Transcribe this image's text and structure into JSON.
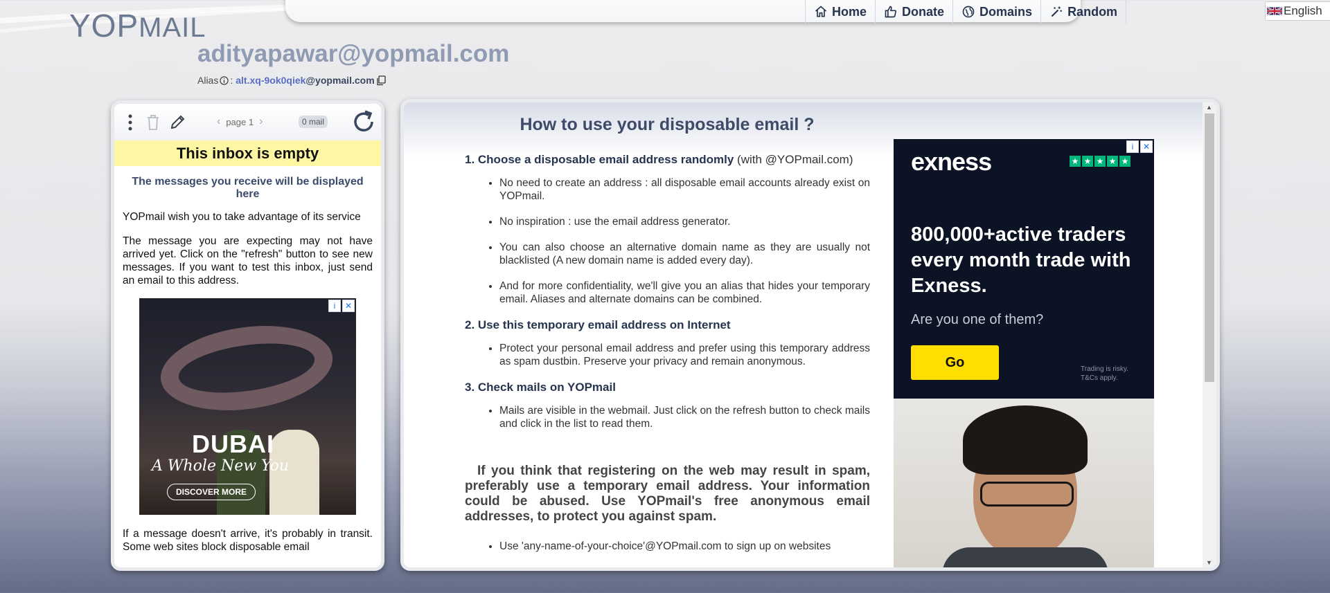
{
  "logo": {
    "text_big": "YOP",
    "text_small": "MAIL"
  },
  "nav": {
    "home": "Home",
    "donate": "Donate",
    "domains": "Domains",
    "random": "Random"
  },
  "language": {
    "selected": "English"
  },
  "inbox": {
    "email": "adityapawar@yopmail.com",
    "alias_label": "Alias",
    "alias_sep": ":",
    "alias_value": "alt.xq-9ok0qiek",
    "alias_domain": "@yopmail.com"
  },
  "left": {
    "page": "page 1",
    "mail_count": "0 mail",
    "empty_title": "This inbox is empty",
    "receive_note": "The messages you receive will be displayed here",
    "wish": "YOPmail wish you to take advantage of its service",
    "expect": "The message you are expecting may not have arrived yet. Click on the \"refresh\" button to see new messages. If you want to test this inbox, just send an email to this address.",
    "transit": "If a message doesn't arrive, it's probably in transit. Some web sites block disposable email",
    "ad": {
      "brand": "DUBAI",
      "tagline": "A Whole New You",
      "cta": "DISCOVER MORE"
    }
  },
  "right": {
    "title": "How to use your disposable email ?",
    "s1_title": "1. Choose a disposable email address randomly",
    "s1_suffix": "(with @YOPmail.com)",
    "s1_items": [
      "No need to create an address : all disposable email accounts already exist on YOPmail.",
      "No inspiration : use the email address generator.",
      "You can also choose an alternative domain name as they are usually not blacklisted (A new domain name is added every day).",
      "And for more confidentiality, we'll give you an alias that hides your temporary email. Aliases and alternate domains can be combined."
    ],
    "s2_title": "2. Use this temporary email address on Internet",
    "s2_items": [
      "Protect your personal email address and prefer using this temporary address as spam dustbin. Preserve your privacy and remain anonymous."
    ],
    "s3_title": "3. Check mails on YOPmail",
    "s3_items": [
      "Mails are visible in the webmail. Just click on the refresh button to check mails and click in the list to read them."
    ],
    "spam_para": "If you think that registering on the web may result in spam, preferably use a temporary email address. Your information could be abused. Use YOPmail's free anonymous email addresses, to protect you against spam.",
    "tail_item": "Use 'any-name-of-your-choice'@YOPmail.com to sign up on websites"
  },
  "ad_right": {
    "brand": "exness",
    "headline": "800,000+active traders every month trade with Exness.",
    "sub": "Are you one of them?",
    "cta": "Go",
    "risk": "Trading is risky. T&Cs apply."
  },
  "colors": {
    "nav_text": "#26344f",
    "email_text": "#8f9bb3",
    "banner_bg": "#fdf7a3",
    "ad_dark": "#0b1325",
    "ad_button": "#ffde02"
  }
}
